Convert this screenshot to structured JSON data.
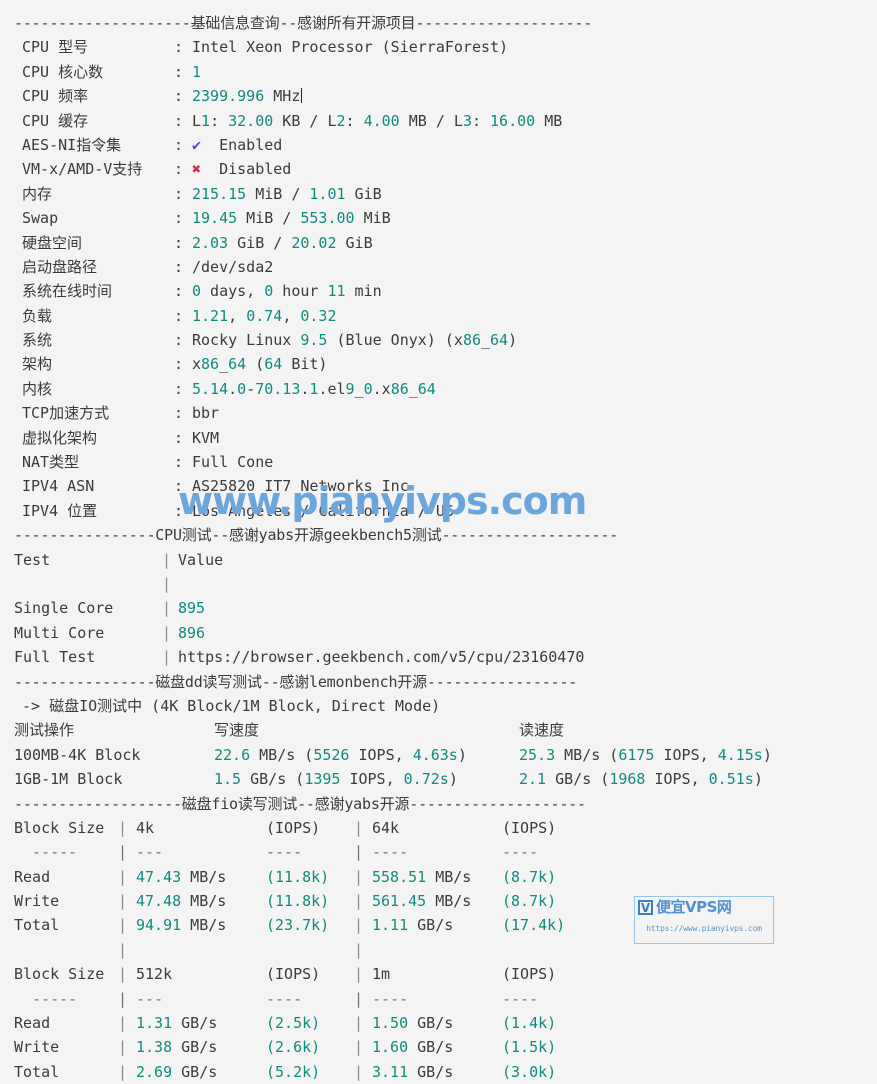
{
  "sections": {
    "basic_header": "--------------------基础信息查询--感谢所有开源项目--------------------",
    "cpu_header": "----------------CPU测试--感谢yabs开源geekbench5测试--------------------",
    "dd_header": "----------------磁盘dd读写测试--感谢lemonbench开源-----------------",
    "fio_header": "-------------------磁盘fio读写测试--感谢yabs开源--------------------"
  },
  "basic_info": [
    {
      "key": "CPU 型号",
      "value": "Intel Xeon Processor (SierraForest)",
      "style": "plain"
    },
    {
      "key": "CPU 核心数",
      "value": "1",
      "style": "num"
    },
    {
      "key": "CPU 频率",
      "value": "2399.996 MHz",
      "style": "freq"
    },
    {
      "key": "CPU 缓存",
      "value": "L1: 32.00 KB / L2: 4.00 MB / L3: 16.00 MB",
      "style": "cache"
    },
    {
      "key": "AES-NI指令集",
      "value": "Enabled",
      "style": "enabled"
    },
    {
      "key": "VM-x/AMD-V支持",
      "value": "Disabled",
      "style": "disabled"
    },
    {
      "key": "内存",
      "value": "215.15 MiB / 1.01 GiB",
      "style": "mem"
    },
    {
      "key": "Swap",
      "value": "19.45 MiB / 553.00 MiB",
      "style": "mem"
    },
    {
      "key": "硬盘空间",
      "value": "2.03 GiB / 20.02 GiB",
      "style": "mem"
    },
    {
      "key": "启动盘路径",
      "value": "/dev/sda2",
      "style": "plain"
    },
    {
      "key": "系统在线时间",
      "value": "0 days, 0 hour 11 min",
      "style": "uptime"
    },
    {
      "key": "负载",
      "value": "1.21, 0.74, 0.32",
      "style": "load"
    },
    {
      "key": "系统",
      "value": "Rocky Linux 9.5 (Blue Onyx) (x86_64)",
      "style": "os"
    },
    {
      "key": "架构",
      "value": "x86_64 (64 Bit)",
      "style": "arch"
    },
    {
      "key": "内核",
      "value": "5.14.0-70.13.1.el9_0.x86_64",
      "style": "num"
    },
    {
      "key": "TCP加速方式",
      "value": "bbr",
      "style": "plain"
    },
    {
      "key": "虚拟化架构",
      "value": "KVM",
      "style": "plain"
    },
    {
      "key": "NAT类型",
      "value": "Full Cone",
      "style": "plain"
    },
    {
      "key": "IPV4 ASN",
      "value": "AS25820 IT7 Networks Inc",
      "style": "plain"
    },
    {
      "key": "IPV4 位置",
      "value": "Los Angeles / California / US",
      "style": "plain"
    }
  ],
  "cpu_test": {
    "col_test": "Test",
    "col_value": "Value",
    "bar": "|",
    "rows": [
      {
        "name": "Single Core",
        "value": "895",
        "style": "num"
      },
      {
        "name": "Multi Core",
        "value": "896",
        "style": "num"
      },
      {
        "name": "Full Test",
        "value": "https://browser.geekbench.com/v5/cpu/23160470",
        "style": "url"
      }
    ]
  },
  "dd_test": {
    "subtitle": "-> 磁盘IO测试中 (4K Block/1M Block, Direct Mode)",
    "col_op": "测试操作",
    "col_write": "写速度",
    "col_read": "读速度",
    "rows": [
      {
        "op": "100MB-4K Block",
        "write_speed": "22.6",
        "write_unit": " MB/s (",
        "write_iops": "5526",
        "write_mid": " IOPS, ",
        "write_time": "4.63s",
        "write_end": ")",
        "read_speed": "25.3",
        "read_unit": " MB/s (",
        "read_iops": "6175",
        "read_mid": " IOPS, ",
        "read_time": "4.15s",
        "read_end": ")"
      },
      {
        "op": "1GB-1M Block",
        "write_speed": "1.5",
        "write_unit": " GB/s (",
        "write_iops": "1395",
        "write_mid": " IOPS, ",
        "write_time": "0.72s",
        "write_end": ")",
        "read_speed": "2.1",
        "read_unit": " GB/s (",
        "read_iops": "1968",
        "read_mid": " IOPS, ",
        "read_time": "0.51s",
        "read_end": ")"
      }
    ]
  },
  "fio_tables": [
    {
      "header_label": "Block Size",
      "bar": "|",
      "block_a": "4k",
      "iops_a": "(IOPS)",
      "block_b": "64k",
      "iops_b": "(IOPS)",
      "dash_label": "-----",
      "dash_a": "---",
      "dash_a2": "----",
      "dash_b": "----",
      "dash_b2": "----",
      "rows": [
        {
          "name": "Read",
          "a_val": "47.43",
          "a_unit": " MB/s",
          "a_iops": "(11.8k)",
          "b_val": "558.51",
          "b_unit": " MB/s",
          "b_iops": "(8.7k)"
        },
        {
          "name": "Write",
          "a_val": "47.48",
          "a_unit": " MB/s",
          "a_iops": "(11.8k)",
          "b_val": "561.45",
          "b_unit": " MB/s",
          "b_iops": "(8.7k)"
        },
        {
          "name": "Total",
          "a_val": "94.91",
          "a_unit": " MB/s",
          "a_iops": "(23.7k)",
          "b_val": "1.11",
          "b_unit": " GB/s",
          "b_iops": "(17.4k)"
        }
      ]
    },
    {
      "header_label": "Block Size",
      "bar": "|",
      "block_a": "512k",
      "iops_a": "(IOPS)",
      "block_b": "1m",
      "iops_b": "(IOPS)",
      "dash_label": "-----",
      "dash_a": "---",
      "dash_a2": "----",
      "dash_b": "----",
      "dash_b2": "----",
      "rows": [
        {
          "name": "Read",
          "a_val": "1.31",
          "a_unit": " GB/s",
          "a_iops": "(2.5k)",
          "b_val": "1.50",
          "b_unit": " GB/s",
          "b_iops": "(1.4k)"
        },
        {
          "name": "Write",
          "a_val": "1.38",
          "a_unit": " GB/s",
          "a_iops": "(2.6k)",
          "b_val": "1.60",
          "b_unit": " GB/s",
          "b_iops": "(1.5k)"
        },
        {
          "name": "Total",
          "a_val": "2.69",
          "a_unit": " GB/s",
          "a_iops": "(5.2k)",
          "b_val": "3.11",
          "b_unit": " GB/s",
          "b_iops": "(3.0k)"
        }
      ]
    }
  ],
  "watermarks": {
    "text": "www.pianyivps.com",
    "logo_mark": "V",
    "logo_brand": "便宜VPS网",
    "logo_url": "https://www.pianyivps.com"
  },
  "colors": {
    "background": "#f4f4f4",
    "text": "#3b3b3b",
    "value_teal": "#118a7e",
    "enabled_blue": "#4a4ad8",
    "disabled_red": "#e0294a",
    "watermark_blue": "#6ba6dd"
  }
}
